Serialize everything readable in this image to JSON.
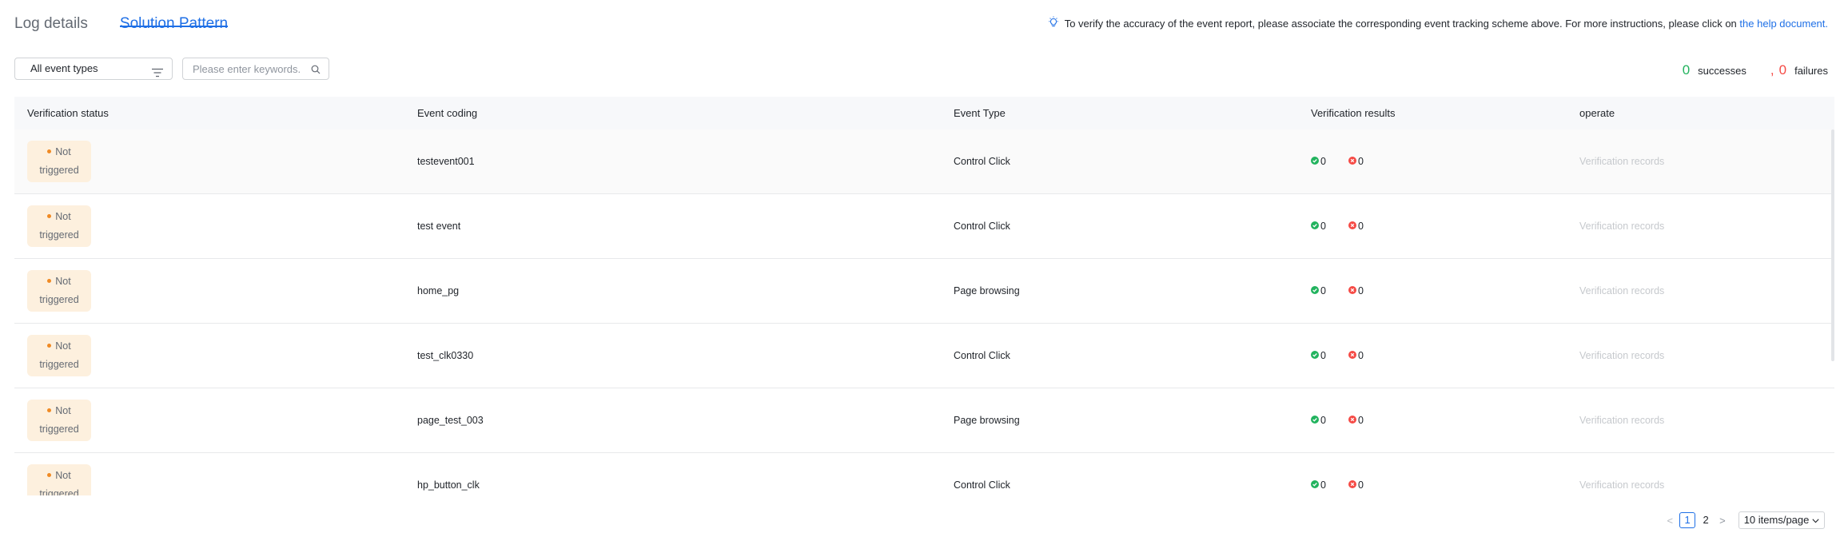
{
  "tabs": [
    {
      "label": "Log details",
      "active": false
    },
    {
      "label": "Solution Pattern",
      "active": true
    }
  ],
  "tip": {
    "text": "To verify the accuracy of the event report, please associate the corresponding event tracking scheme above. For more instructions, please click on",
    "link": "the help document."
  },
  "filter": {
    "select_label": "All event types",
    "search_placeholder": "Please enter keywords.",
    "search_value": ""
  },
  "stats": {
    "successes_count": "0",
    "successes_label": "successes",
    "separator": ",",
    "failures_count": "0",
    "failures_label": "failures"
  },
  "table": {
    "headers": [
      "Verification status",
      "Event coding",
      "Event Type",
      "Verification results",
      "operate"
    ],
    "rows": [
      {
        "status_1": "Not",
        "status_2": "triggered",
        "code": "testevent001",
        "type": "Control Click",
        "success": "0",
        "fail": "0",
        "op": "Verification records"
      },
      {
        "status_1": "Not",
        "status_2": "triggered",
        "code": "test event",
        "type": "Control Click",
        "success": "0",
        "fail": "0",
        "op": "Verification records"
      },
      {
        "status_1": "Not",
        "status_2": "triggered",
        "code": "home_pg",
        "type": "Page browsing",
        "success": "0",
        "fail": "0",
        "op": "Verification records"
      },
      {
        "status_1": "Not",
        "status_2": "triggered",
        "code": "test_clk0330",
        "type": "Control Click",
        "success": "0",
        "fail": "0",
        "op": "Verification records"
      },
      {
        "status_1": "Not",
        "status_2": "triggered",
        "code": "page_test_003",
        "type": "Page browsing",
        "success": "0",
        "fail": "0",
        "op": "Verification records"
      },
      {
        "status_1": "Not",
        "status_2": "triggered",
        "code": "hp_button_clk",
        "type": "Control Click",
        "success": "0",
        "fail": "0",
        "op": "Verification records"
      }
    ]
  },
  "pagination": {
    "prev": "<",
    "pages": [
      "1",
      "2"
    ],
    "current": "1",
    "next": ">",
    "page_size": "10 items/page"
  },
  "colors": {
    "accent": "#1e6fe6",
    "success": "#22b35e",
    "failure": "#f54a45",
    "badge_bg": "#fdf0de",
    "badge_dot": "#f08a24"
  }
}
